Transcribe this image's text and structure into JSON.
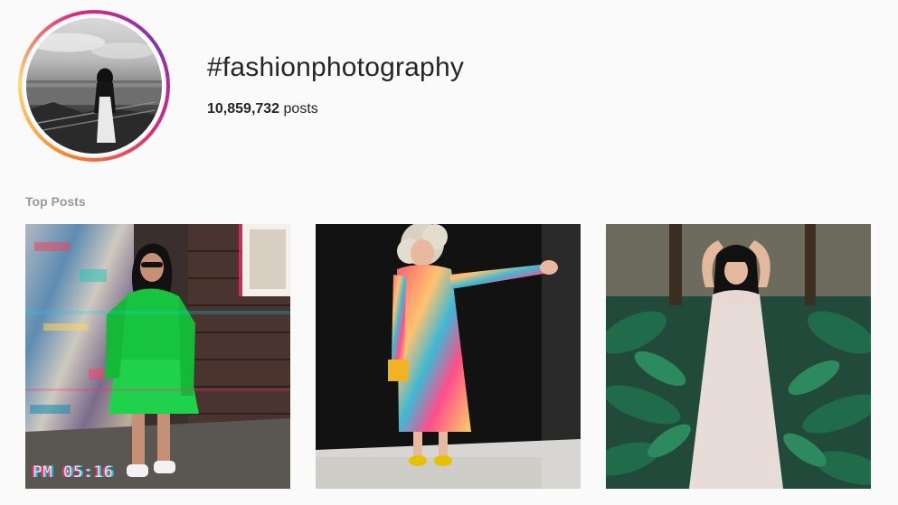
{
  "header": {
    "hashtag": "#fashionphotography",
    "post_count": "10,859,732",
    "post_count_suffix": "posts"
  },
  "sections": {
    "top_posts_label": "Top Posts"
  },
  "posts": [
    {
      "overlay_text": "PM  05:16"
    },
    {
      "overlay_text": ""
    },
    {
      "overlay_text": ""
    }
  ],
  "colors": {
    "background": "#fafafa",
    "text": "#262626",
    "muted": "#999999",
    "ring_orange": "#f58529",
    "ring_pink": "#dd2a7b",
    "ring_purple": "#8134af"
  }
}
